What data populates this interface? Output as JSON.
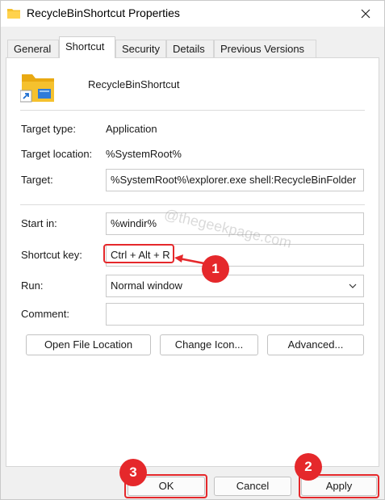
{
  "window": {
    "title": "RecycleBinShortcut Properties"
  },
  "tabs": [
    {
      "label": "General"
    },
    {
      "label": "Shortcut"
    },
    {
      "label": "Security"
    },
    {
      "label": "Details"
    },
    {
      "label": "Previous Versions"
    }
  ],
  "shortcut": {
    "name": "RecycleBinShortcut",
    "target_type_label": "Target type:",
    "target_type_value": "Application",
    "target_location_label": "Target location:",
    "target_location_value": "%SystemRoot%",
    "target_label": "Target:",
    "target_value": "%SystemRoot%\\explorer.exe shell:RecycleBinFolder",
    "start_in_label": "Start in:",
    "start_in_value": "%windir%",
    "shortcut_key_label": "Shortcut key:",
    "shortcut_key_value": "Ctrl + Alt + R",
    "run_label": "Run:",
    "run_value": "Normal window",
    "comment_label": "Comment:",
    "comment_value": ""
  },
  "actions": {
    "open_file_location": "Open File Location",
    "change_icon": "Change Icon...",
    "advanced": "Advanced..."
  },
  "footer": {
    "ok": "OK",
    "cancel": "Cancel",
    "apply": "Apply"
  },
  "annotations": {
    "step1": "1",
    "step2": "2",
    "step3": "3"
  },
  "watermark": "@thegeekpage.com",
  "colors": {
    "annotation": "#e5282b",
    "folder": "#f5c12e"
  }
}
